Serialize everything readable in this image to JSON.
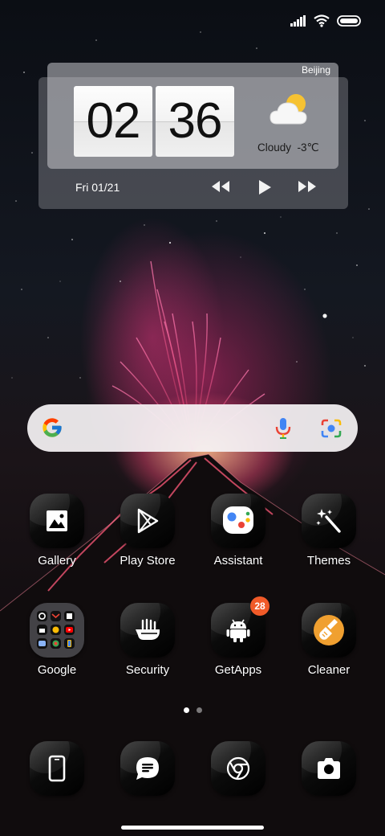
{
  "status_bar": {
    "icons": [
      "signal-icon",
      "wifi-icon",
      "battery-icon"
    ]
  },
  "clock_widget": {
    "city": "Beijing",
    "hour": "02",
    "minute": "36",
    "weather_icon": "partly-cloudy-icon",
    "weather_condition": "Cloudy",
    "temperature": "-3℃",
    "date": "Fri 01/21",
    "media_controls": [
      "rewind-icon",
      "play-icon",
      "fast-forward-icon"
    ]
  },
  "search_bar": {
    "icons": [
      "google-g-icon",
      "microphone-icon",
      "lens-camera-icon"
    ]
  },
  "apps_row1": [
    {
      "label": "Gallery",
      "icon": "gallery-icon"
    },
    {
      "label": "Play Store",
      "icon": "play-store-icon"
    },
    {
      "label": "Assistant",
      "icon": "assistant-icon"
    },
    {
      "label": "Themes",
      "icon": "themes-icon"
    }
  ],
  "apps_row2": [
    {
      "label": "Google",
      "icon": "folder-icon"
    },
    {
      "label": "Security",
      "icon": "security-icon"
    },
    {
      "label": "GetApps",
      "icon": "getapps-icon",
      "badge": "28"
    },
    {
      "label": "Cleaner",
      "icon": "cleaner-icon"
    }
  ],
  "page_indicator": {
    "pages": 2,
    "active": 1
  },
  "dock": [
    {
      "icon": "phone-icon"
    },
    {
      "icon": "messages-icon"
    },
    {
      "icon": "chrome-icon"
    },
    {
      "icon": "camera-icon"
    }
  ],
  "colors": {
    "badge": "#f05a28",
    "accent_glow": "#e0407e"
  }
}
